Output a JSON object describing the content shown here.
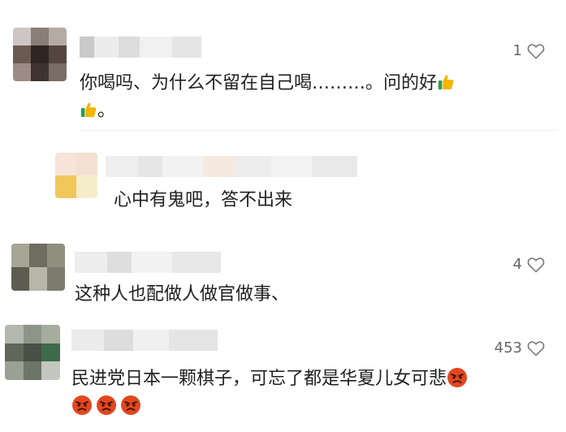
{
  "comments": [
    {
      "text": "你喝吗、为什么不留在自己喝………。问的好",
      "text_tail": "。",
      "likes": "1"
    },
    {
      "text": "心中有鬼吧，答不出来"
    },
    {
      "text": "这种人也配做人做官做事、",
      "likes": "4"
    },
    {
      "text": "民进党日本一颗棋子，可忘了都是华夏儿女可悲",
      "likes": "453"
    }
  ],
  "icons": {
    "like": "heart-outline-icon",
    "thumbs_up": "thumbs-up-emoji",
    "angry": "angry-face-emoji"
  },
  "colors": {
    "text": "#1f1f1f",
    "like_count": "#666666",
    "divider": "#ececec",
    "thumb_yellow": "#f4b400",
    "thumb_green": "#2e9d46",
    "angry_red": "#e2471f"
  }
}
